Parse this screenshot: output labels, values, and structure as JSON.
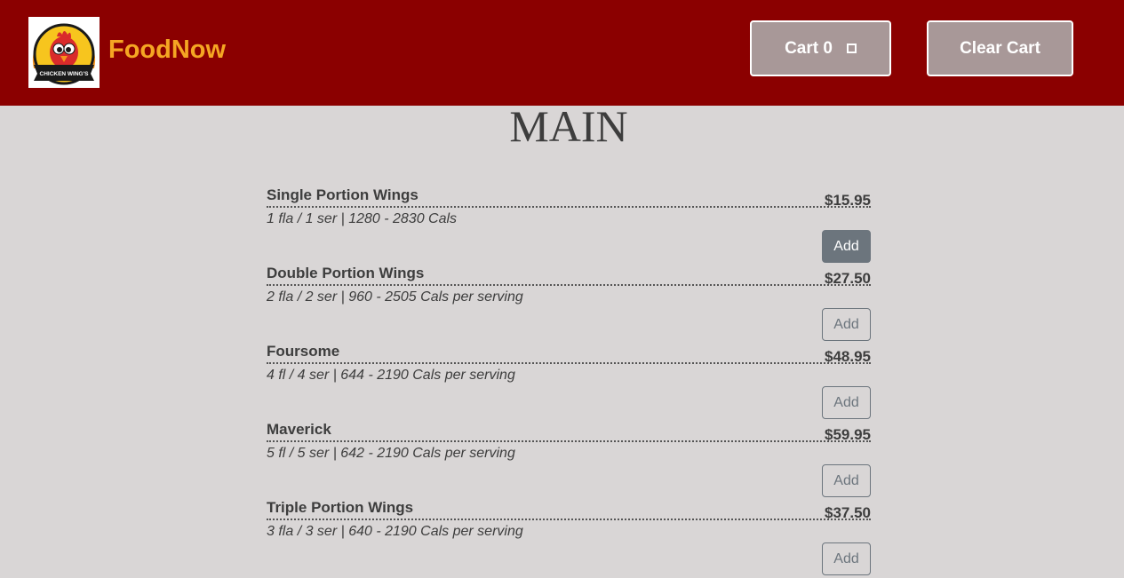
{
  "header": {
    "brand": "FoodNow",
    "logo_text": "CHICKEN WING'S",
    "cart_label": "Cart 0",
    "clear_cart_label": "Clear Cart"
  },
  "section": {
    "title": "MAIN"
  },
  "menu_items": [
    {
      "name": "Single Portion Wings",
      "price": "$15.95",
      "desc": "1 fla / 1 ser | 1280 - 2830 Cals",
      "add_label": "Add"
    },
    {
      "name": "Double Portion Wings",
      "price": "$27.50",
      "desc": "2 fla / 2 ser | 960 - 2505 Cals per serving",
      "add_label": "Add"
    },
    {
      "name": "Foursome",
      "price": "$48.95",
      "desc": "4 fl / 4 ser | 644 - 2190 Cals per serving",
      "add_label": "Add"
    },
    {
      "name": "Maverick",
      "price": "$59.95",
      "desc": "5 fl / 5 ser | 642 - 2190 Cals per serving",
      "add_label": "Add"
    },
    {
      "name": "Triple Portion Wings",
      "price": "$37.50",
      "desc": "3 fla / 3 ser | 640 - 2190 Cals per serving",
      "add_label": "Add"
    }
  ],
  "colors": {
    "navbar": "#8b0000",
    "brand": "#f5a623",
    "background": "#d9d6d6",
    "button_gray": "#6c757d"
  }
}
